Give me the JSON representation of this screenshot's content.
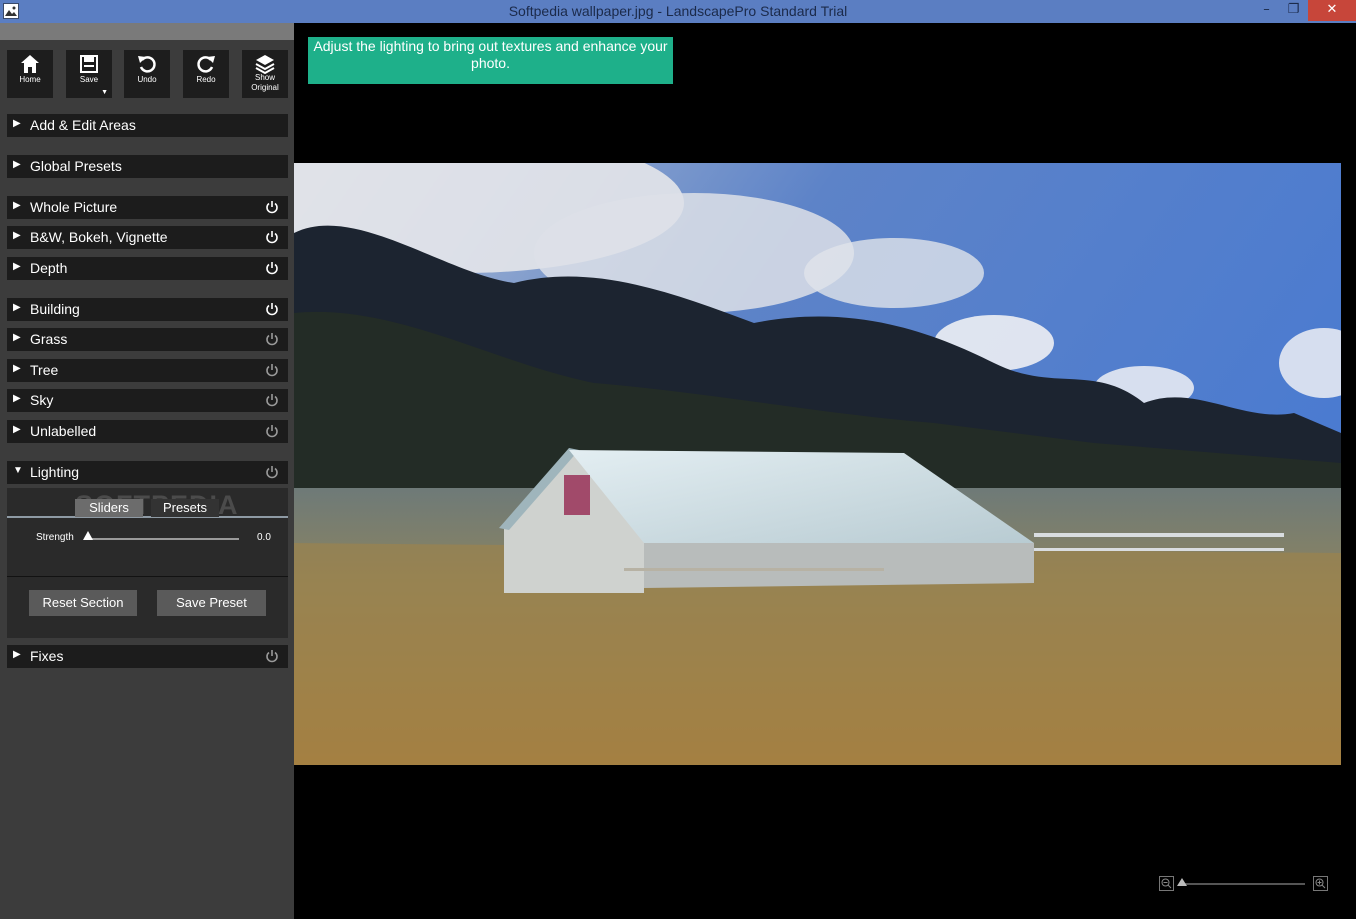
{
  "window": {
    "title": "Softpedia wallpaper.jpg - LandscapePro Standard Trial",
    "controls": {
      "minimize": "–",
      "maximize": "❐",
      "close": "✕"
    }
  },
  "toolbar": {
    "buttons": [
      {
        "id": "home",
        "label": "Home",
        "icon": "home-icon"
      },
      {
        "id": "save",
        "label": "Save",
        "icon": "save-icon"
      },
      {
        "id": "undo",
        "label": "Undo",
        "icon": "undo-icon"
      },
      {
        "id": "redo",
        "label": "Redo",
        "icon": "redo-icon"
      },
      {
        "id": "show-original",
        "label_line1": "Show",
        "label_line2": "Original",
        "icon": "layers-icon"
      }
    ]
  },
  "sections": {
    "add_edit": "Add & Edit Areas",
    "global_presets": "Global Presets",
    "whole_picture": "Whole Picture",
    "bw": "B&W, Bokeh, Vignette",
    "depth": "Depth",
    "building": "Building",
    "grass": "Grass",
    "tree": "Tree",
    "sky": "Sky",
    "unlabelled": "Unlabelled",
    "lighting": "Lighting",
    "fixes": "Fixes"
  },
  "lighting_panel": {
    "watermark": "SOFTPEDIA",
    "tabs": {
      "sliders": "Sliders",
      "presets": "Presets"
    },
    "slider": {
      "label": "Strength",
      "value": "0.0",
      "fraction": 0.0
    },
    "buttons": {
      "reset": "Reset Section",
      "save_preset": "Save Preset"
    }
  },
  "hint": "Adjust the lighting to bring out textures and enhance your photo.",
  "arrows": {
    "collapsed": "▶",
    "expanded": "▼"
  },
  "colors": {
    "accent": "#1eb08a",
    "titlebar": "#5b7ec2",
    "close": "#c7463a"
  }
}
